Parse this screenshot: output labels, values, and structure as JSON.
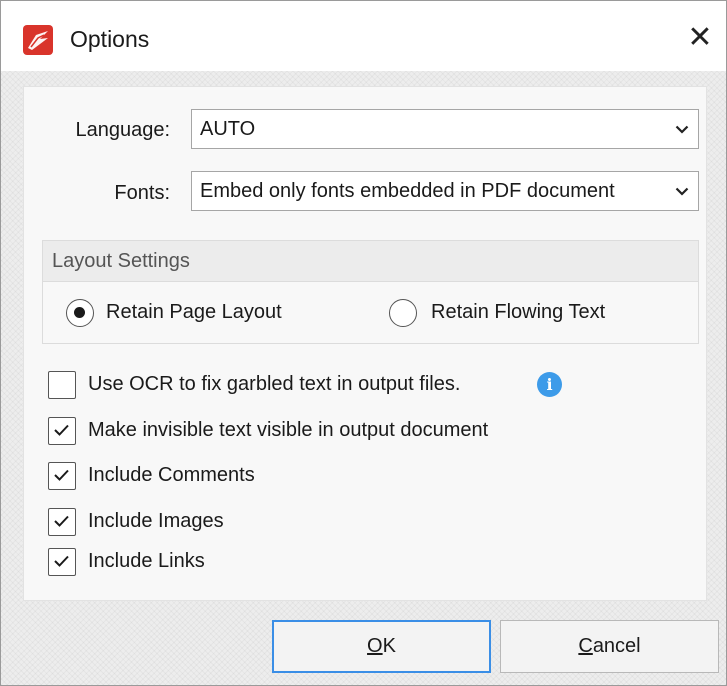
{
  "dialog": {
    "title": "Options",
    "close_glyph": "✕"
  },
  "language": {
    "label": "Language:",
    "value": "AUTO"
  },
  "fonts": {
    "label": "Fonts:",
    "value": "Embed only fonts embedded in PDF document"
  },
  "layout": {
    "group_title": "Layout Settings",
    "options": [
      {
        "label": "Retain Page Layout",
        "selected": true
      },
      {
        "label": "Retain Flowing Text",
        "selected": false
      }
    ]
  },
  "checkboxes": [
    {
      "label": "Use OCR to fix garbled text in output files.",
      "checked": false
    },
    {
      "label": "Make invisible text visible in output document",
      "checked": true
    },
    {
      "label": "Include Comments",
      "checked": true
    },
    {
      "label": "Include Images",
      "checked": true
    },
    {
      "label": "Include Links",
      "checked": true
    }
  ],
  "info_icon_glyph": "i",
  "buttons": {
    "ok_mnemonic": "O",
    "ok_rest": "K",
    "cancel_mnemonic": "C",
    "cancel_rest": "ancel"
  },
  "colors": {
    "accent": "#3a8ee6",
    "info": "#3d9be9",
    "app_icon": "#d9342b"
  },
  "icons": {
    "app": "pdf-xchange-logo-icon",
    "close": "close-icon",
    "dropdown": "chevron-down-icon",
    "info": "info-icon",
    "check": "checkmark-icon"
  }
}
